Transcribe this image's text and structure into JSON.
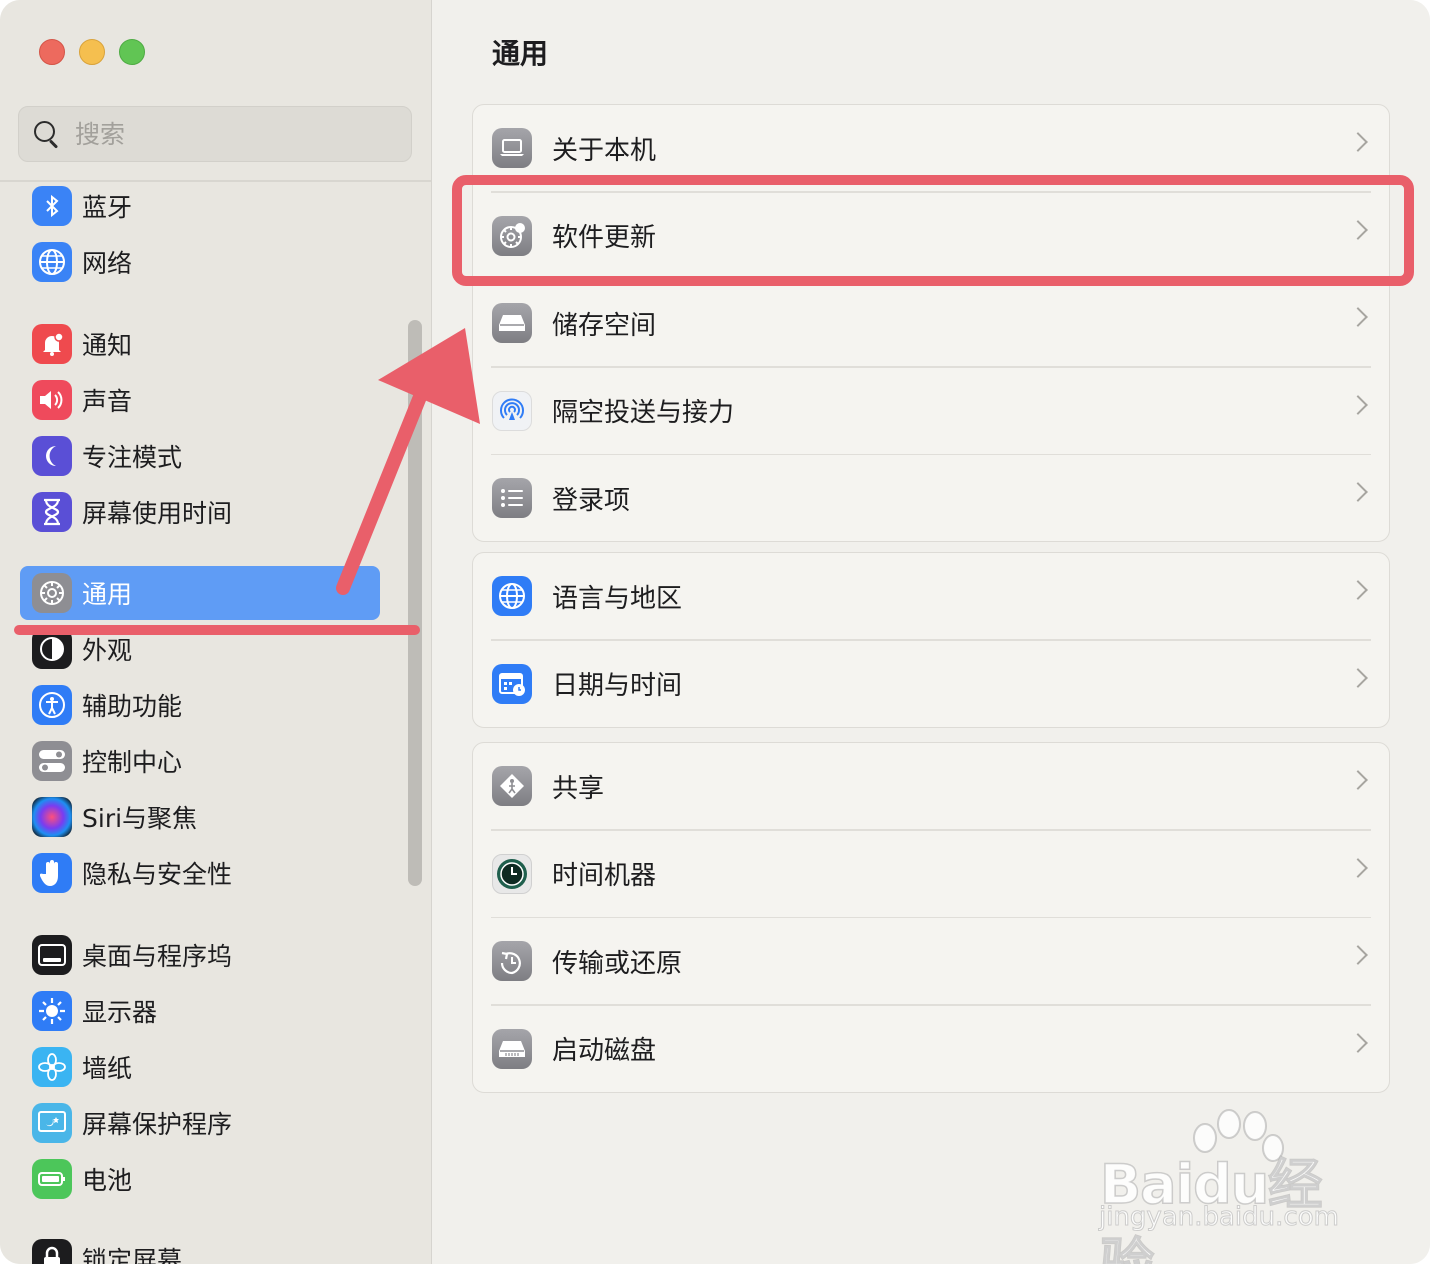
{
  "search": {
    "placeholder": "搜索"
  },
  "sidebar": {
    "items": [
      {
        "label": "蓝牙",
        "icon": "bluetooth-icon"
      },
      {
        "label": "网络",
        "icon": "network-globe-icon"
      },
      {
        "label": "通知",
        "icon": "bell-icon"
      },
      {
        "label": "声音",
        "icon": "speaker-icon"
      },
      {
        "label": "专注模式",
        "icon": "moon-icon"
      },
      {
        "label": "屏幕使用时间",
        "icon": "hourglass-icon"
      },
      {
        "label": "通用",
        "icon": "gear-icon",
        "selected": true
      },
      {
        "label": "外观",
        "icon": "appearance-icon"
      },
      {
        "label": "辅助功能",
        "icon": "accessibility-icon"
      },
      {
        "label": "控制中心",
        "icon": "toggles-icon"
      },
      {
        "label": "Siri与聚焦",
        "icon": "siri-icon"
      },
      {
        "label": "隐私与安全性",
        "icon": "hand-icon"
      },
      {
        "label": "桌面与程序坞",
        "icon": "dock-icon"
      },
      {
        "label": "显示器",
        "icon": "sun-icon"
      },
      {
        "label": "墙纸",
        "icon": "flower-icon"
      },
      {
        "label": "屏幕保护程序",
        "icon": "screensaver-icon"
      },
      {
        "label": "电池",
        "icon": "battery-icon"
      },
      {
        "label": "锁定屏幕",
        "icon": "lock-icon"
      }
    ]
  },
  "main": {
    "title": "通用",
    "groups": [
      {
        "rows": [
          {
            "label": "关于本机",
            "icon": "laptop-icon"
          },
          {
            "label": "软件更新",
            "icon": "gear-badge-icon"
          },
          {
            "label": "储存空间",
            "icon": "drive-icon"
          },
          {
            "label": "隔空投送与接力",
            "icon": "airdrop-icon"
          },
          {
            "label": "登录项",
            "icon": "list-icon"
          }
        ]
      },
      {
        "rows": [
          {
            "label": "语言与地区",
            "icon": "globe-icon"
          },
          {
            "label": "日期与时间",
            "icon": "calendar-clock-icon"
          }
        ]
      },
      {
        "rows": [
          {
            "label": "共享",
            "icon": "sharing-icon"
          },
          {
            "label": "时间机器",
            "icon": "time-machine-icon"
          },
          {
            "label": "传输或还原",
            "icon": "restore-icon"
          },
          {
            "label": "启动磁盘",
            "icon": "disk-icon"
          }
        ]
      }
    ]
  },
  "watermark": {
    "main": "Baidu经验",
    "sub": "jingyan.baidu.com"
  },
  "colors": {
    "accent": "#5f9cf5",
    "annotation": "#e95f6a"
  }
}
